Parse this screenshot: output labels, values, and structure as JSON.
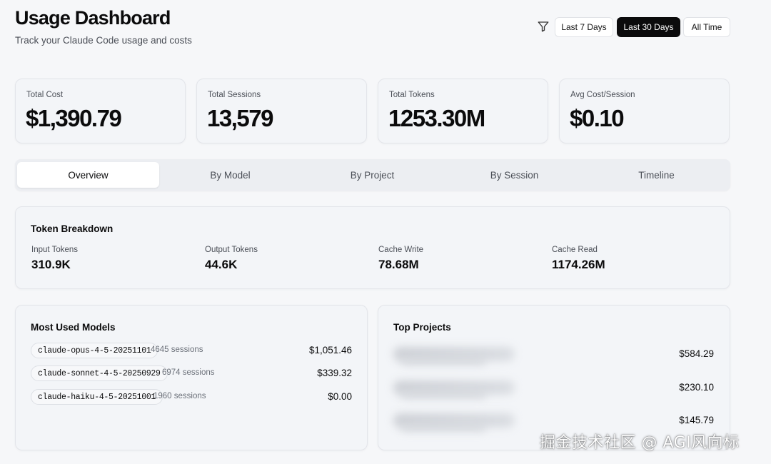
{
  "header": {
    "title": "Usage Dashboard",
    "subtitle": "Track your Claude Code usage and costs",
    "filter_icon": "filter-icon",
    "ranges": [
      {
        "label": "Last 7 Days",
        "active": false
      },
      {
        "label": "Last 30 Days",
        "active": true
      },
      {
        "label": "All Time",
        "active": false
      }
    ]
  },
  "stats": [
    {
      "label": "Total Cost",
      "value": "$1,390.79"
    },
    {
      "label": "Total Sessions",
      "value": "13,579"
    },
    {
      "label": "Total Tokens",
      "value": "1253.30M"
    },
    {
      "label": "Avg Cost/Session",
      "value": "$0.10"
    }
  ],
  "tabs": [
    {
      "label": "Overview",
      "active": true
    },
    {
      "label": "By Model",
      "active": false
    },
    {
      "label": "By Project",
      "active": false
    },
    {
      "label": "By Session",
      "active": false
    },
    {
      "label": "Timeline",
      "active": false
    }
  ],
  "token_breakdown": {
    "title": "Token Breakdown",
    "items": [
      {
        "label": "Input Tokens",
        "value": "310.9K"
      },
      {
        "label": "Output Tokens",
        "value": "44.6K"
      },
      {
        "label": "Cache Write",
        "value": "78.68M"
      },
      {
        "label": "Cache Read",
        "value": "1174.26M"
      }
    ]
  },
  "models": {
    "title": "Most Used Models",
    "rows": [
      {
        "name": "claude-opus-4-5-20251101",
        "sessions": "4645 sessions",
        "cost": "$1,051.46"
      },
      {
        "name": "claude-sonnet-4-5-20250929",
        "sessions": "6974 sessions",
        "cost": "$339.32"
      },
      {
        "name": "claude-haiku-4-5-20251001",
        "sessions": "1960 sessions",
        "cost": "$0.00"
      }
    ]
  },
  "projects": {
    "title": "Top Projects",
    "rows": [
      {
        "cost": "$584.29"
      },
      {
        "cost": "$230.10"
      },
      {
        "cost": "$145.79"
      }
    ]
  },
  "watermark": "掘金技术社区 @ AGI风向标",
  "colors": {
    "background": "#f6f7f9",
    "card": "#f3f5f8",
    "active_button": "#0b0b0c",
    "muted_text": "#4b4f57"
  }
}
